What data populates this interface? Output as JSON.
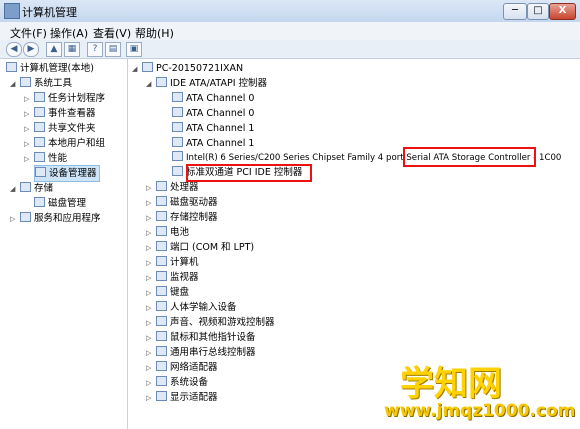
{
  "window": {
    "title": "计算机管理",
    "min": "─",
    "max": "□",
    "close": "X"
  },
  "menu": [
    "文件(F)",
    "操作(A)",
    "查看(V)",
    "帮助(H)"
  ],
  "left_tree": [
    {
      "label": "计算机管理(本地)",
      "level": 0,
      "exp": ""
    },
    {
      "label": "系统工具",
      "level": 1,
      "exp": "◢"
    },
    {
      "label": "任务计划程序",
      "level": 2,
      "exp": "▷"
    },
    {
      "label": "事件查看器",
      "level": 2,
      "exp": "▷"
    },
    {
      "label": "共享文件夹",
      "level": 2,
      "exp": "▷"
    },
    {
      "label": "本地用户和组",
      "level": 2,
      "exp": "▷"
    },
    {
      "label": "性能",
      "level": 2,
      "exp": "▷"
    },
    {
      "label": "设备管理器",
      "level": 2,
      "exp": ""
    },
    {
      "label": "存储",
      "level": 1,
      "exp": "◢"
    },
    {
      "label": "磁盘管理",
      "level": 2,
      "exp": ""
    },
    {
      "label": "服务和应用程序",
      "level": 1,
      "exp": "▷"
    }
  ],
  "right_tree": [
    {
      "label": "PC-20150721IXAN",
      "level": 0,
      "exp": "◢"
    },
    {
      "label": "IDE ATA/ATAPI 控制器",
      "level": 1,
      "exp": "◢"
    },
    {
      "label": "ATA Channel 0",
      "level": 2,
      "exp": ""
    },
    {
      "label": "ATA Channel 0",
      "level": 2,
      "exp": ""
    },
    {
      "label": "ATA Channel 1",
      "level": 2,
      "exp": ""
    },
    {
      "label": "ATA Channel 1",
      "level": 2,
      "exp": ""
    },
    {
      "label": "Intel(R) 6 Series/C200 Series Chipset Family 4 port Serial ATA Storage Controller - 1C00",
      "level": 2,
      "exp": ""
    },
    {
      "label": "标准双通道 PCI IDE 控制器",
      "level": 2,
      "exp": ""
    },
    {
      "label": "处理器",
      "level": 1,
      "exp": "▷"
    },
    {
      "label": "磁盘驱动器",
      "level": 1,
      "exp": "▷"
    },
    {
      "label": "存储控制器",
      "level": 1,
      "exp": "▷"
    },
    {
      "label": "电池",
      "level": 1,
      "exp": "▷"
    },
    {
      "label": "端口 (COM 和 LPT)",
      "level": 1,
      "exp": "▷"
    },
    {
      "label": "计算机",
      "level": 1,
      "exp": "▷"
    },
    {
      "label": "监视器",
      "level": 1,
      "exp": "▷"
    },
    {
      "label": "键盘",
      "level": 1,
      "exp": "▷"
    },
    {
      "label": "人体学输入设备",
      "level": 1,
      "exp": "▷"
    },
    {
      "label": "声音、视频和游戏控制器",
      "level": 1,
      "exp": "▷"
    },
    {
      "label": "鼠标和其他指针设备",
      "level": 1,
      "exp": "▷"
    },
    {
      "label": "通用串行总线控制器",
      "level": 1,
      "exp": "▷"
    },
    {
      "label": "网络适配器",
      "level": 1,
      "exp": "▷"
    },
    {
      "label": "系统设备",
      "level": 1,
      "exp": "▷"
    },
    {
      "label": "显示适配器",
      "level": 1,
      "exp": "▷"
    }
  ],
  "toolbar_icons": [
    "back-icon",
    "forward-icon",
    "up-folder-icon",
    "show-tree-icon",
    "help-icon",
    "properties-icon",
    "computer-icon"
  ],
  "watermark": {
    "main": "学知网",
    "url": "www.jmqz1000.com"
  },
  "colors": {
    "highlight_box": "#ee1111",
    "selection": "#cde3f7",
    "watermark": "#ffd200"
  }
}
